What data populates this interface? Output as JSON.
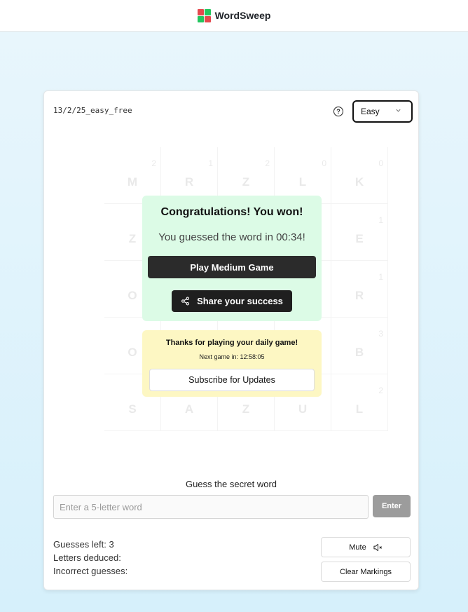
{
  "header": {
    "brand": "WordSweep",
    "logo_colors": [
      "#e5484d",
      "#22c55e",
      "#22c55e",
      "#e5484d"
    ]
  },
  "game": {
    "id": "13/2/25_easy_free",
    "help_icon": "question-circle-icon",
    "difficulty": "Easy",
    "dropdown_icon": "chevron-down-icon"
  },
  "board": {
    "rows": [
      [
        {
          "letter": "M",
          "num": "2"
        },
        {
          "letter": "R",
          "num": "1"
        },
        {
          "letter": "Z",
          "num": "2"
        },
        {
          "letter": "L",
          "num": "0"
        },
        {
          "letter": "K",
          "num": "0"
        }
      ],
      [
        {
          "letter": "Z",
          "num": ""
        },
        {
          "letter": "",
          "num": ""
        },
        {
          "letter": "",
          "num": ""
        },
        {
          "letter": "",
          "num": ""
        },
        {
          "letter": "E",
          "num": "1"
        }
      ],
      [
        {
          "letter": "O",
          "num": "3"
        },
        {
          "letter": "",
          "num": ""
        },
        {
          "letter": "",
          "num": ""
        },
        {
          "letter": "",
          "num": ""
        },
        {
          "letter": "R",
          "num": "1"
        }
      ],
      [
        {
          "letter": "O",
          "num": "3"
        },
        {
          "letter": "",
          "num": ""
        },
        {
          "letter": "",
          "num": ""
        },
        {
          "letter": "",
          "num": ""
        },
        {
          "letter": "B",
          "num": "3"
        }
      ],
      [
        {
          "letter": "S",
          "num": ""
        },
        {
          "letter": "A",
          "num": ""
        },
        {
          "letter": "Z",
          "num": ""
        },
        {
          "letter": "U",
          "num": ""
        },
        {
          "letter": "L",
          "num": "2"
        }
      ]
    ]
  },
  "win": {
    "title": "Congratulations! You won!",
    "subtitle": "You guessed the word in 00:34!",
    "play_medium": "Play Medium Game",
    "share": "Share your success",
    "share_icon": "share-icon",
    "bg": "#dcfbe6"
  },
  "daily": {
    "title": "Thanks for playing your daily game!",
    "next": "Next game in: 12:58:05",
    "subscribe": "Subscribe for Updates",
    "bg": "#fdf7c3"
  },
  "guess": {
    "label": "Guess the secret word",
    "placeholder": "Enter a 5-letter word",
    "value": "",
    "enter": "Enter"
  },
  "stats": {
    "guesses_left": "Guesses left: 3",
    "letters_deduced": "Letters deduced:",
    "incorrect": "Incorrect guesses:"
  },
  "controls": {
    "mute": "Mute",
    "mute_icon": "speaker-muted-icon",
    "clear": "Clear Markings"
  }
}
